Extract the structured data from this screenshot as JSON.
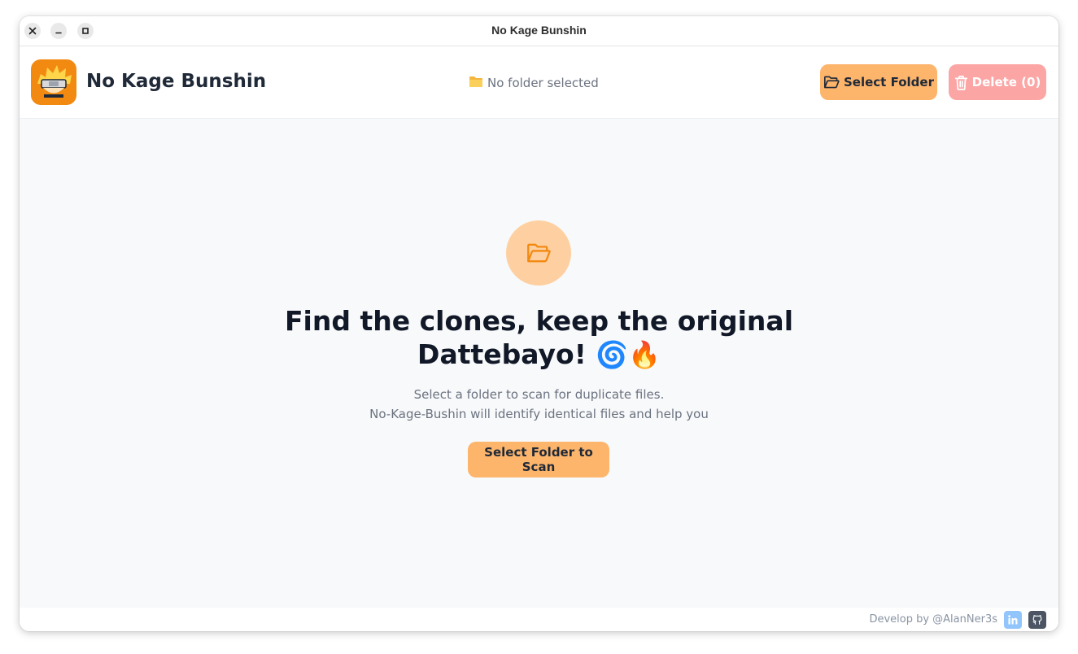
{
  "window": {
    "title": "No Kage Bunshin",
    "controls": [
      "close-icon",
      "minimize-icon",
      "maximize-icon"
    ]
  },
  "header": {
    "app_name": "No Kage Bunshin",
    "logo_icon": "naruto-logo-icon",
    "folder_status_icon": "folder-emoji-icon",
    "folder_status": "No folder selected",
    "select_folder_label": "Select Folder",
    "delete_label": "Delete (0)"
  },
  "main": {
    "empty_icon": "folder-open-icon",
    "headline_line1": "Find the clones, keep the original",
    "headline_line2": "Dattebayo!",
    "headline_emojis": "🌀🔥",
    "subtext_line1": "Select a folder to scan for duplicate files.",
    "subtext_line2": "No-Kage-Bushin will identify identical files and help you",
    "scan_button_label": "Select Folder to Scan"
  },
  "footer": {
    "credit": "Develop by @AlanNer3s",
    "links": [
      "linkedin-icon",
      "github-icon"
    ]
  },
  "colors": {
    "accent": "#fdb46b",
    "accent_strong": "#f28a12",
    "danger": "#fca5a5",
    "text_dark": "#111827",
    "text_muted": "#6b7280"
  }
}
